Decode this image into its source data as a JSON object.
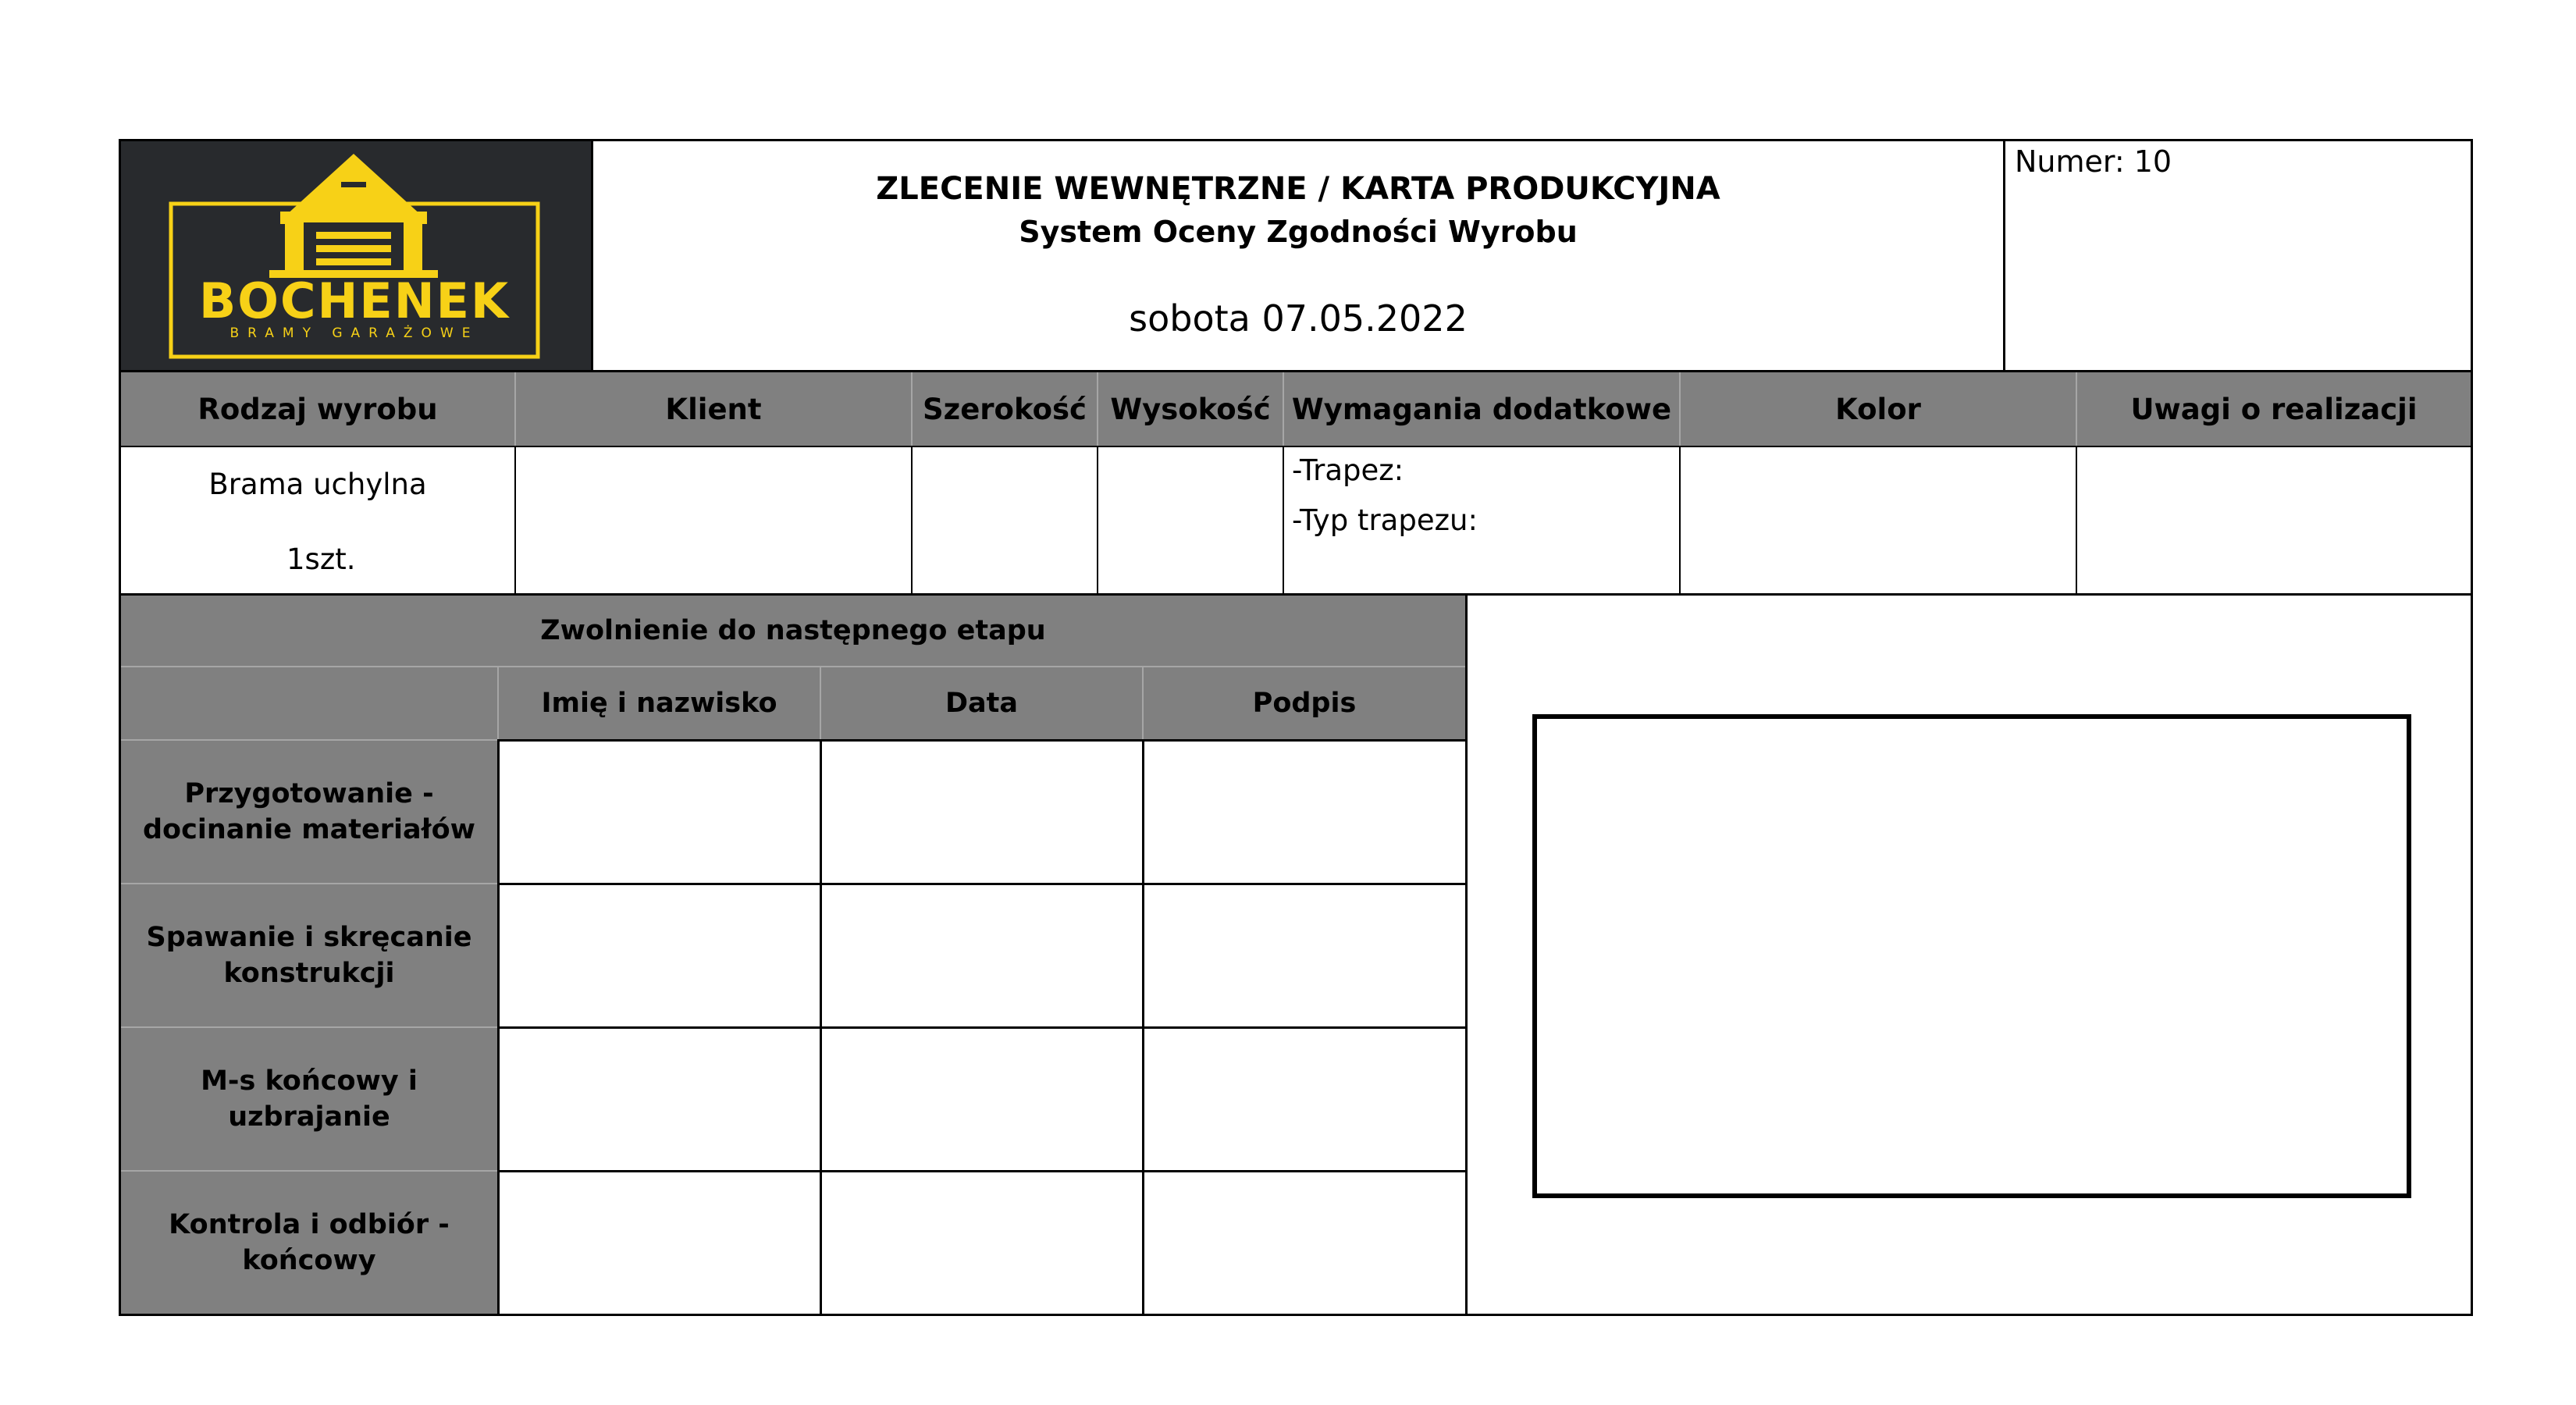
{
  "logo": {
    "name": "BOCHENEK",
    "tagline": "BRAMY GARAŻOWE",
    "accent": "#f7d117",
    "background": "#282a2d"
  },
  "header": {
    "title": "ZLECENIE WEWNĘTRZNE / KARTA PRODUKCYJNA",
    "subtitle": "System Oceny Zgodności Wyrobu",
    "date": "sobota 07.05.2022",
    "number": "Numer: 10"
  },
  "product": {
    "headers": [
      "Rodzaj wyrobu",
      "Klient",
      "Szerokość",
      "Wysokość",
      "Wymagania dodatkowe",
      "Kolor",
      "Uwagi o realizacji"
    ],
    "type_line1": "Brama uchylna",
    "type_line2": "1szt.",
    "requirements_line1": "-Trapez:",
    "requirements_line2": "-Typ trapezu:"
  },
  "release": {
    "title": "Zwolnienie do następnego etapu",
    "columns": [
      "Imię i nazwisko",
      "Data",
      "Podpis"
    ],
    "stages": [
      "Przygotowanie - docinanie materiałów",
      "Spawanie i skręcanie konstrukcji",
      "M-s końcowy i uzbrajanie",
      "Kontrola i odbiór - końcowy"
    ]
  },
  "colors": {
    "header_grey": "#808080",
    "border": "#000000"
  }
}
